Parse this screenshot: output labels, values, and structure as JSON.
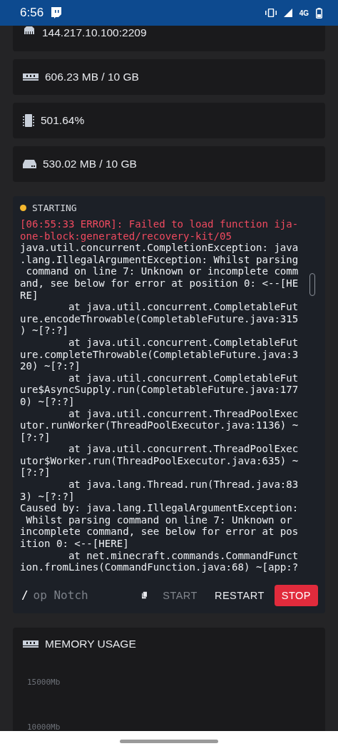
{
  "status_bar": {
    "time": "6:56",
    "network": "4G"
  },
  "stats": [
    {
      "kind": "network",
      "value": "144.217.10.100:2209"
    },
    {
      "kind": "memory",
      "value": "606.23 MB / 10 GB"
    },
    {
      "kind": "cpu",
      "value": "501.64%"
    },
    {
      "kind": "disk",
      "value": "530.02 MB / 10 GB"
    }
  ],
  "console": {
    "status": {
      "label": "STARTING",
      "color": "#f5b82e"
    },
    "lines": [
      {
        "kind": "error",
        "text": "[06:55:33 ERROR]: Failed to load function ija-"
      },
      {
        "kind": "error",
        "text": "one-block:generated/recovery-kit/05"
      },
      {
        "kind": "info",
        "text": "java.util.concurrent.CompletionException: java"
      },
      {
        "kind": "info",
        "text": ".lang.IllegalArgumentException: Whilst parsing"
      },
      {
        "kind": "info",
        "text": " command on line 7: Unknown or incomplete comm"
      },
      {
        "kind": "info",
        "text": "and, see below for error at position 0: <--[HE"
      },
      {
        "kind": "info",
        "text": "RE]"
      },
      {
        "kind": "info",
        "text": "        at java.util.concurrent.CompletableFut"
      },
      {
        "kind": "info",
        "text": "ure.encodeThrowable(CompletableFuture.java:315"
      },
      {
        "kind": "info",
        "text": ") ~[?:?]"
      },
      {
        "kind": "info",
        "text": "        at java.util.concurrent.CompletableFut"
      },
      {
        "kind": "info",
        "text": "ure.completeThrowable(CompletableFuture.java:3"
      },
      {
        "kind": "info",
        "text": "20) ~[?:?]"
      },
      {
        "kind": "info",
        "text": "        at java.util.concurrent.CompletableFut"
      },
      {
        "kind": "info",
        "text": "ure$AsyncSupply.run(CompletableFuture.java:177"
      },
      {
        "kind": "info",
        "text": "0) ~[?:?]"
      },
      {
        "kind": "info",
        "text": "        at java.util.concurrent.ThreadPoolExec"
      },
      {
        "kind": "info",
        "text": "utor.runWorker(ThreadPoolExecutor.java:1136) ~"
      },
      {
        "kind": "info",
        "text": "[?:?]"
      },
      {
        "kind": "info",
        "text": "        at java.util.concurrent.ThreadPoolExec"
      },
      {
        "kind": "info",
        "text": "utor$Worker.run(ThreadPoolExecutor.java:635) ~"
      },
      {
        "kind": "info",
        "text": "[?:?]"
      },
      {
        "kind": "info",
        "text": "        at java.lang.Thread.run(Thread.java:83"
      },
      {
        "kind": "info",
        "text": "3) ~[?:?]"
      },
      {
        "kind": "info",
        "text": "Caused by: java.lang.IllegalArgumentException:"
      },
      {
        "kind": "info",
        "text": " Whilst parsing command on line 7: Unknown or"
      },
      {
        "kind": "info",
        "text": "incomplete command, see below for error at pos"
      },
      {
        "kind": "info",
        "text": "ition 0: <--[HERE]"
      },
      {
        "kind": "info",
        "text": "        at net.minecraft.commands.CommandFunct"
      },
      {
        "kind": "info",
        "text": "ion.fromLines(CommandFunction.java:68) ~[app:?"
      }
    ],
    "prompt": "/",
    "command_placeholder": "op Notch",
    "buttons": [
      {
        "label": "START",
        "kind": "start",
        "disabled": true
      },
      {
        "label": "RESTART",
        "kind": "restart",
        "disabled": false
      },
      {
        "label": "STOP",
        "kind": "stop",
        "disabled": false
      }
    ]
  },
  "memory_usage": {
    "title": "MEMORY USAGE",
    "axis_labels": [
      "15000Mb",
      "10000Mb"
    ]
  }
}
